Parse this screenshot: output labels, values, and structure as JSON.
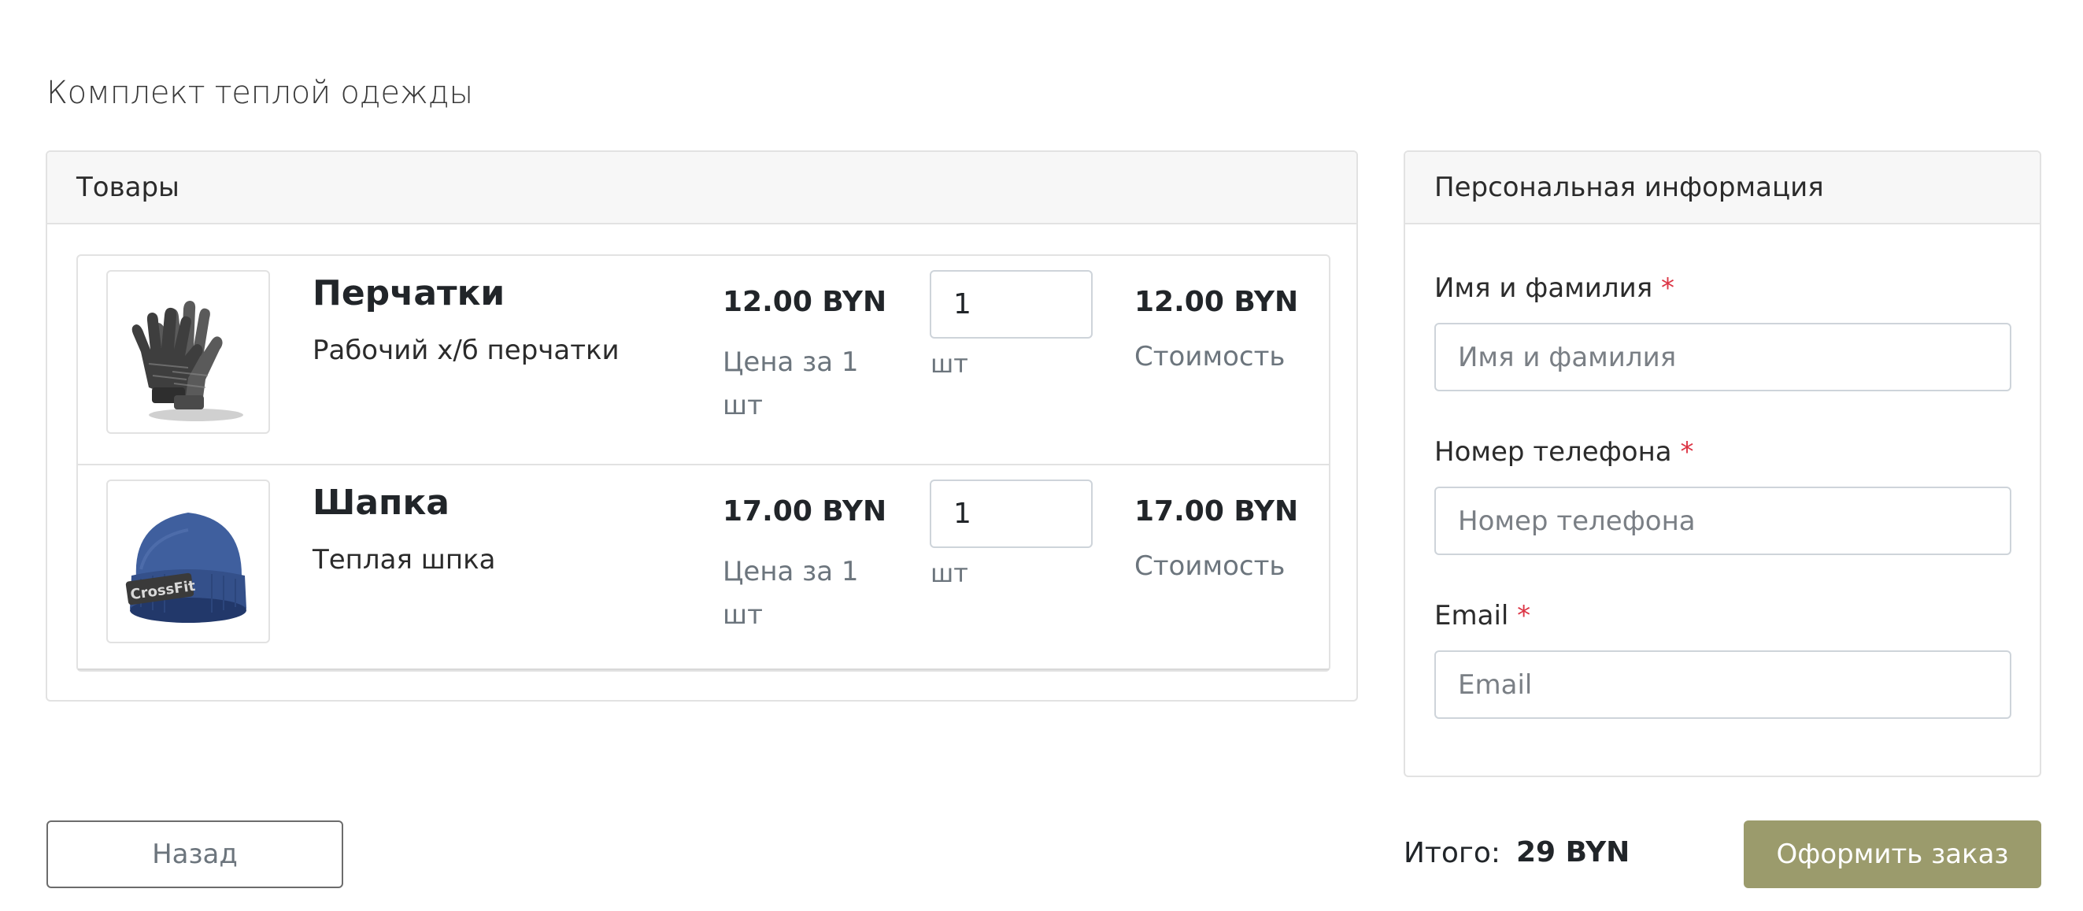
{
  "page": {
    "title": "Комплект теплой одежды"
  },
  "products_card": {
    "header": "Товары",
    "items": [
      {
        "name": "Перчатки",
        "description": "Рабочий х/б перчатки",
        "price": "12.00 BYN",
        "price_label": "Цена за 1 шт",
        "quantity": "1",
        "unit": "шт",
        "total": "12.00 BYN",
        "total_label": "Стоимость",
        "image_icon": "gloves-image"
      },
      {
        "name": "Шапка",
        "description": "Теплая шпка",
        "price": "17.00 BYN",
        "price_label": "Цена за 1 шт",
        "quantity": "1",
        "unit": "шт",
        "total": "17.00 BYN",
        "total_label": "Стоимость",
        "image_icon": "beanie-image",
        "image_text": "CrossFit"
      }
    ]
  },
  "info_card": {
    "header": "Персональная информация",
    "fields": [
      {
        "label": "Имя и фамилия",
        "required_mark": "*",
        "placeholder": "Имя и фамилия",
        "value": ""
      },
      {
        "label": "Номер телефона",
        "required_mark": "*",
        "placeholder": "Номер телефона",
        "value": ""
      },
      {
        "label": "Email",
        "required_mark": "*",
        "placeholder": "Email",
        "value": ""
      }
    ]
  },
  "footer": {
    "back_label": "Назад",
    "total_text": "Итого:",
    "total_value": "29 BYN",
    "submit_label": "Оформить заказ"
  },
  "colors": {
    "accent": "#9b9b6c",
    "required": "#dc3545",
    "muted_text": "#6c757d",
    "border": "#e2e2e2"
  }
}
